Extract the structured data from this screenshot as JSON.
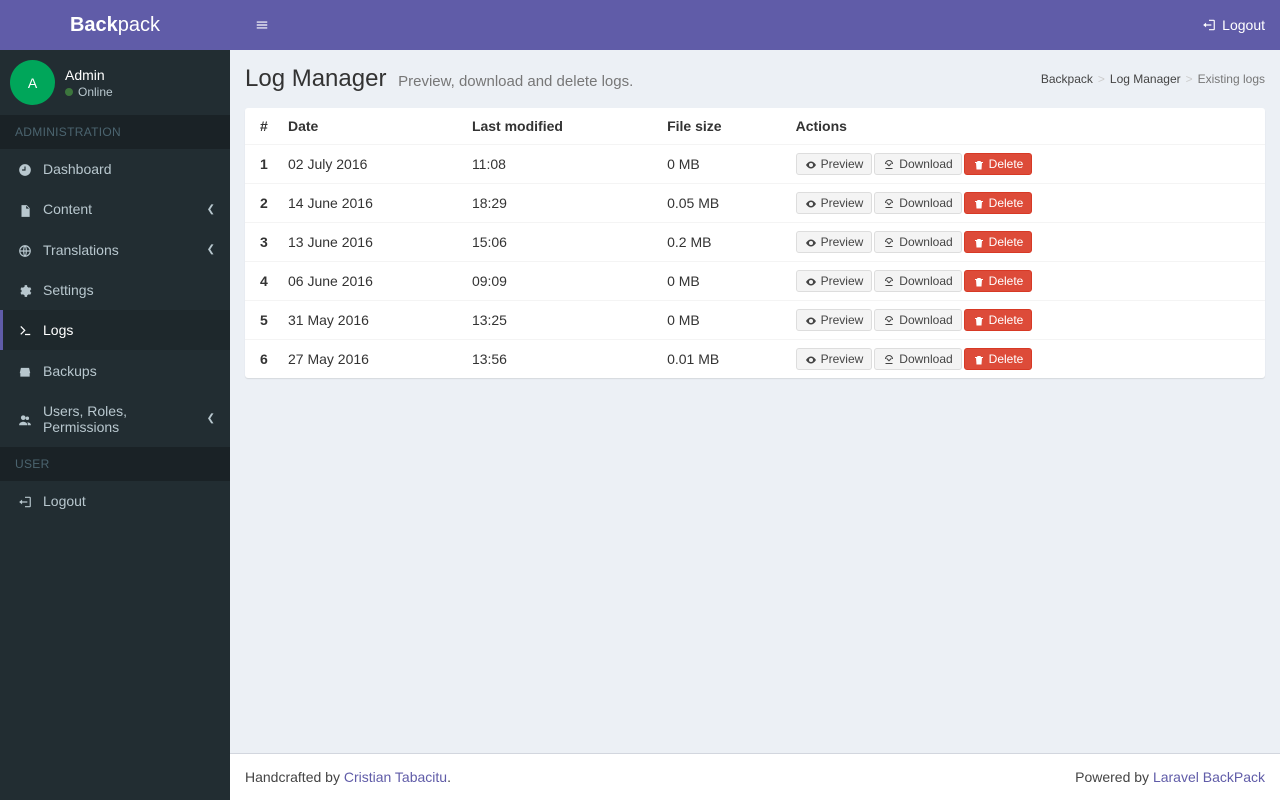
{
  "brand": {
    "bold": "Back",
    "light": "pack"
  },
  "top": {
    "logout": "Logout"
  },
  "user": {
    "initial": "A",
    "name": "Admin",
    "status": "Online"
  },
  "sidebar": {
    "section1": "ADMINISTRATION",
    "section2": "USER",
    "items": {
      "dashboard": "Dashboard",
      "content": "Content",
      "translations": "Translations",
      "settings": "Settings",
      "logs": "Logs",
      "backups": "Backups",
      "users": "Users, Roles, Permissions",
      "logout": "Logout"
    }
  },
  "page": {
    "title": "Log Manager",
    "subtitle": "Preview, download and delete logs.",
    "crumb1": "Backpack",
    "crumb2": "Log Manager",
    "crumb3": "Existing logs"
  },
  "table": {
    "headers": {
      "num": "#",
      "date": "Date",
      "modified": "Last modified",
      "size": "File size",
      "actions": "Actions"
    },
    "rows": [
      {
        "n": "1",
        "date": "02 July 2016",
        "mod": "11:08",
        "size": "0 MB"
      },
      {
        "n": "2",
        "date": "14 June 2016",
        "mod": "18:29",
        "size": "0.05 MB"
      },
      {
        "n": "3",
        "date": "13 June 2016",
        "mod": "15:06",
        "size": "0.2 MB"
      },
      {
        "n": "4",
        "date": "06 June 2016",
        "mod": "09:09",
        "size": "0 MB"
      },
      {
        "n": "5",
        "date": "31 May 2016",
        "mod": "13:25",
        "size": "0 MB"
      },
      {
        "n": "6",
        "date": "27 May 2016",
        "mod": "13:56",
        "size": "0.01 MB"
      }
    ],
    "actions": {
      "preview": "Preview",
      "download": "Download",
      "delete": "Delete"
    }
  },
  "footer": {
    "left_pre": "Handcrafted by ",
    "left_link": "Cristian Tabacitu",
    "left_post": ".",
    "right_pre": "Powered by ",
    "right_link": "Laravel BackPack"
  }
}
